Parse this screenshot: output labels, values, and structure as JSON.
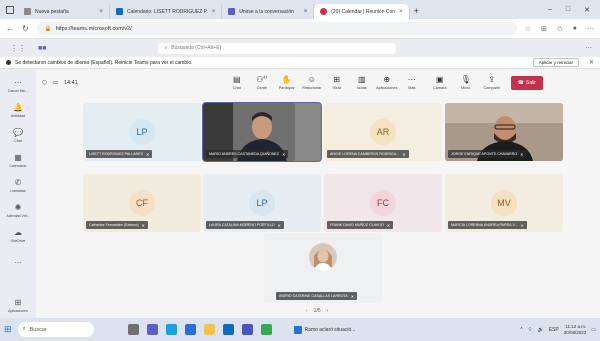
{
  "browser": {
    "tabs": [
      {
        "title": "Nueva pestaña",
        "color": "#8a8a8a"
      },
      {
        "title": "Calendario: LISETT RODRIGUEZ P.",
        "color": "#0f6cbd"
      },
      {
        "title": "Unirse a la conversación",
        "color": "#5b5fc7"
      },
      {
        "title": "(20) Calendar | Reunión Con",
        "color": "#c4314b"
      }
    ],
    "url": "https://teams.microsoft.com/v2/"
  },
  "teams": {
    "search_placeholder": "Búsqueda (Ctrl+Alt+E)",
    "banner_text": "Se detectaron cambios de idioma (Español). Reinicie Teams para ver el cambio.",
    "banner_action": "Aplicar y reiniciar"
  },
  "appbar": [
    {
      "label": "Cancel Min...",
      "icon": "dots-icon"
    },
    {
      "label": "Actividad",
      "icon": "bell-icon"
    },
    {
      "label": "Chat",
      "icon": "chat-icon"
    },
    {
      "label": "Calendario",
      "icon": "calendar-icon"
    },
    {
      "label": "Llamadas",
      "icon": "phone-icon"
    },
    {
      "label": "Actividad Virt...",
      "icon": "bolt-icon"
    },
    {
      "label": "OneDrive",
      "icon": "cloud-icon"
    },
    {
      "label": "...",
      "icon": "more-icon"
    },
    {
      "label": "Aplicaciones",
      "icon": "apps-icon"
    }
  ],
  "meeting": {
    "timer": "14:41",
    "toolbar": [
      {
        "label": "Chat",
        "icon": "chat-icon"
      },
      {
        "label": "Gente",
        "icon": "people-icon",
        "count": "42"
      },
      {
        "label": "Participar",
        "icon": "hand-icon"
      },
      {
        "label": "Reaccionar",
        "icon": "smile-icon"
      },
      {
        "label": "Vista",
        "icon": "grid-icon"
      },
      {
        "label": "Notas",
        "icon": "notes-icon"
      },
      {
        "label": "Aplicaciones",
        "icon": "plus-icon"
      },
      {
        "label": "Más",
        "icon": "more-icon"
      }
    ],
    "media": [
      {
        "label": "Cámara",
        "icon": "camera-icon"
      },
      {
        "label": "Micro",
        "icon": "mic-icon"
      },
      {
        "label": "Compartir",
        "icon": "share-icon"
      }
    ],
    "leave_label": "Salir",
    "pager": "1/5",
    "participants": [
      {
        "initials": "LP",
        "name": "LISETT RODRIGUEZ PALLARES",
        "bg": "#e4eef2",
        "avatar": "#d7e7f1",
        "fg": "#2f6a94"
      },
      {
        "initials": "",
        "name": "MARIO ANDRES CASTANEDA QUIÑONEZ",
        "bg": "#6b6b6b",
        "avatar": "",
        "fg": ""
      },
      {
        "initials": "AR",
        "name": "ANGIE LORENA CAMBEROS RODRIGU...",
        "bg": "#f3eedf",
        "avatar": "#f4e3c2",
        "fg": "#8a6513"
      },
      {
        "initials": "",
        "name": "JORGE ENRIQUE APONTE CHAVARRO",
        "bg": "#9a8c80",
        "avatar": "",
        "fg": ""
      },
      {
        "initials": "CF",
        "name": "Catherine Fernandez (Externo)",
        "bg": "#f2ecdf",
        "avatar": "#f5e0c6",
        "fg": "#9a5a17"
      },
      {
        "initials": "LP",
        "name": "LAURA CATALINA MORENO PORTILLO",
        "bg": "#e6eef3",
        "avatar": "#d8e6f0",
        "fg": "#2f6a94"
      },
      {
        "initials": "FC",
        "name": "FRANK DAVID MUÑOZ CLAVIJO",
        "bg": "#f3e6ea",
        "avatar": "#f3d6dc",
        "fg": "#a2344d"
      },
      {
        "initials": "MV",
        "name": "MARCIA LORENNA ANDREA PARRA V...",
        "bg": "#f3ece0",
        "avatar": "#f5e0c2",
        "fg": "#9a5a17"
      },
      {
        "initials": "",
        "name": "INGRID CATERINE CASALLAS LARROTA",
        "bg": "#eef0f2",
        "avatar": "",
        "fg": ""
      }
    ]
  },
  "taskbar": {
    "search": "Buscar",
    "notification": "Ramo aclaró situació...",
    "lang": "ESP",
    "time": "11:12 a.m.",
    "date": "30/08/2023"
  }
}
